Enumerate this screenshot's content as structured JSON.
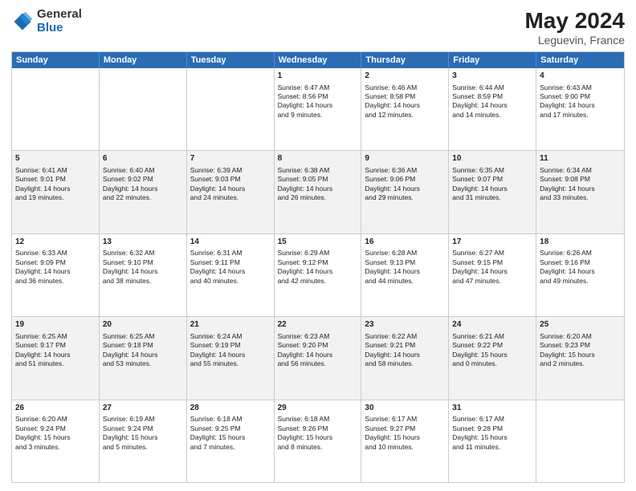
{
  "logo": {
    "general": "General",
    "blue": "Blue"
  },
  "title": {
    "month": "May 2024",
    "location": "Leguevin, France"
  },
  "header_days": [
    "Sunday",
    "Monday",
    "Tuesday",
    "Wednesday",
    "Thursday",
    "Friday",
    "Saturday"
  ],
  "rows": [
    [
      {
        "day": "",
        "lines": []
      },
      {
        "day": "",
        "lines": []
      },
      {
        "day": "",
        "lines": []
      },
      {
        "day": "1",
        "lines": [
          "Sunrise: 6:47 AM",
          "Sunset: 8:56 PM",
          "Daylight: 14 hours",
          "and 9 minutes."
        ]
      },
      {
        "day": "2",
        "lines": [
          "Sunrise: 6:46 AM",
          "Sunset: 8:58 PM",
          "Daylight: 14 hours",
          "and 12 minutes."
        ]
      },
      {
        "day": "3",
        "lines": [
          "Sunrise: 6:44 AM",
          "Sunset: 8:59 PM",
          "Daylight: 14 hours",
          "and 14 minutes."
        ]
      },
      {
        "day": "4",
        "lines": [
          "Sunrise: 6:43 AM",
          "Sunset: 9:00 PM",
          "Daylight: 14 hours",
          "and 17 minutes."
        ]
      }
    ],
    [
      {
        "day": "5",
        "lines": [
          "Sunrise: 6:41 AM",
          "Sunset: 9:01 PM",
          "Daylight: 14 hours",
          "and 19 minutes."
        ]
      },
      {
        "day": "6",
        "lines": [
          "Sunrise: 6:40 AM",
          "Sunset: 9:02 PM",
          "Daylight: 14 hours",
          "and 22 minutes."
        ]
      },
      {
        "day": "7",
        "lines": [
          "Sunrise: 6:39 AM",
          "Sunset: 9:03 PM",
          "Daylight: 14 hours",
          "and 24 minutes."
        ]
      },
      {
        "day": "8",
        "lines": [
          "Sunrise: 6:38 AM",
          "Sunset: 9:05 PM",
          "Daylight: 14 hours",
          "and 26 minutes."
        ]
      },
      {
        "day": "9",
        "lines": [
          "Sunrise: 6:36 AM",
          "Sunset: 9:06 PM",
          "Daylight: 14 hours",
          "and 29 minutes."
        ]
      },
      {
        "day": "10",
        "lines": [
          "Sunrise: 6:35 AM",
          "Sunset: 9:07 PM",
          "Daylight: 14 hours",
          "and 31 minutes."
        ]
      },
      {
        "day": "11",
        "lines": [
          "Sunrise: 6:34 AM",
          "Sunset: 9:08 PM",
          "Daylight: 14 hours",
          "and 33 minutes."
        ]
      }
    ],
    [
      {
        "day": "12",
        "lines": [
          "Sunrise: 6:33 AM",
          "Sunset: 9:09 PM",
          "Daylight: 14 hours",
          "and 36 minutes."
        ]
      },
      {
        "day": "13",
        "lines": [
          "Sunrise: 6:32 AM",
          "Sunset: 9:10 PM",
          "Daylight: 14 hours",
          "and 38 minutes."
        ]
      },
      {
        "day": "14",
        "lines": [
          "Sunrise: 6:31 AM",
          "Sunset: 9:11 PM",
          "Daylight: 14 hours",
          "and 40 minutes."
        ]
      },
      {
        "day": "15",
        "lines": [
          "Sunrise: 6:29 AM",
          "Sunset: 9:12 PM",
          "Daylight: 14 hours",
          "and 42 minutes."
        ]
      },
      {
        "day": "16",
        "lines": [
          "Sunrise: 6:28 AM",
          "Sunset: 9:13 PM",
          "Daylight: 14 hours",
          "and 44 minutes."
        ]
      },
      {
        "day": "17",
        "lines": [
          "Sunrise: 6:27 AM",
          "Sunset: 9:15 PM",
          "Daylight: 14 hours",
          "and 47 minutes."
        ]
      },
      {
        "day": "18",
        "lines": [
          "Sunrise: 6:26 AM",
          "Sunset: 9:16 PM",
          "Daylight: 14 hours",
          "and 49 minutes."
        ]
      }
    ],
    [
      {
        "day": "19",
        "lines": [
          "Sunrise: 6:25 AM",
          "Sunset: 9:17 PM",
          "Daylight: 14 hours",
          "and 51 minutes."
        ]
      },
      {
        "day": "20",
        "lines": [
          "Sunrise: 6:25 AM",
          "Sunset: 9:18 PM",
          "Daylight: 14 hours",
          "and 53 minutes."
        ]
      },
      {
        "day": "21",
        "lines": [
          "Sunrise: 6:24 AM",
          "Sunset: 9:19 PM",
          "Daylight: 14 hours",
          "and 55 minutes."
        ]
      },
      {
        "day": "22",
        "lines": [
          "Sunrise: 6:23 AM",
          "Sunset: 9:20 PM",
          "Daylight: 14 hours",
          "and 56 minutes."
        ]
      },
      {
        "day": "23",
        "lines": [
          "Sunrise: 6:22 AM",
          "Sunset: 9:21 PM",
          "Daylight: 14 hours",
          "and 58 minutes."
        ]
      },
      {
        "day": "24",
        "lines": [
          "Sunrise: 6:21 AM",
          "Sunset: 9:22 PM",
          "Daylight: 15 hours",
          "and 0 minutes."
        ]
      },
      {
        "day": "25",
        "lines": [
          "Sunrise: 6:20 AM",
          "Sunset: 9:23 PM",
          "Daylight: 15 hours",
          "and 2 minutes."
        ]
      }
    ],
    [
      {
        "day": "26",
        "lines": [
          "Sunrise: 6:20 AM",
          "Sunset: 9:24 PM",
          "Daylight: 15 hours",
          "and 3 minutes."
        ]
      },
      {
        "day": "27",
        "lines": [
          "Sunrise: 6:19 AM",
          "Sunset: 9:24 PM",
          "Daylight: 15 hours",
          "and 5 minutes."
        ]
      },
      {
        "day": "28",
        "lines": [
          "Sunrise: 6:18 AM",
          "Sunset: 9:25 PM",
          "Daylight: 15 hours",
          "and 7 minutes."
        ]
      },
      {
        "day": "29",
        "lines": [
          "Sunrise: 6:18 AM",
          "Sunset: 9:26 PM",
          "Daylight: 15 hours",
          "and 8 minutes."
        ]
      },
      {
        "day": "30",
        "lines": [
          "Sunrise: 6:17 AM",
          "Sunset: 9:27 PM",
          "Daylight: 15 hours",
          "and 10 minutes."
        ]
      },
      {
        "day": "31",
        "lines": [
          "Sunrise: 6:17 AM",
          "Sunset: 9:28 PM",
          "Daylight: 15 hours",
          "and 11 minutes."
        ]
      },
      {
        "day": "",
        "lines": []
      }
    ]
  ]
}
